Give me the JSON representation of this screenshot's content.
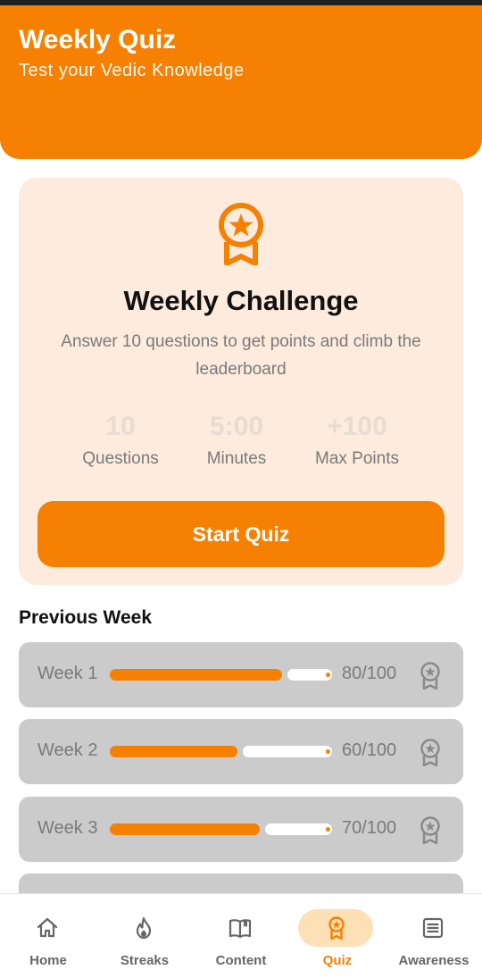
{
  "header": {
    "title": "Weekly Quiz",
    "subtitle": "Test your Vedic Knowledge"
  },
  "challenge": {
    "icon": "medal-icon",
    "title": "Weekly Challenge",
    "description": "Answer 10 questions to get points and climb the leaderboard",
    "stats": [
      {
        "value": "10",
        "label": "Questions"
      },
      {
        "value": "5:00",
        "label": "Minutes"
      },
      {
        "value": "+100",
        "label": "Max Points"
      }
    ],
    "start_button": "Start Quiz"
  },
  "previous": {
    "title": "Previous Week",
    "weeks": [
      {
        "label": "Week 1",
        "score": "80/100",
        "progress": 0.8
      },
      {
        "label": "Week 2",
        "score": "60/100",
        "progress": 0.6
      },
      {
        "label": "Week 3",
        "score": "70/100",
        "progress": 0.7
      }
    ]
  },
  "nav": {
    "items": [
      {
        "label": "Home",
        "icon": "home-icon"
      },
      {
        "label": "Streaks",
        "icon": "flame-icon"
      },
      {
        "label": "Content",
        "icon": "book-icon"
      },
      {
        "label": "Quiz",
        "icon": "medal-icon",
        "active": true
      },
      {
        "label": "Awareness",
        "icon": "document-icon"
      }
    ]
  },
  "colors": {
    "accent": "#f58002",
    "card_bg": "#fdebdd",
    "row_bg": "#cbcbcb",
    "active_pill": "#fde0b6"
  }
}
